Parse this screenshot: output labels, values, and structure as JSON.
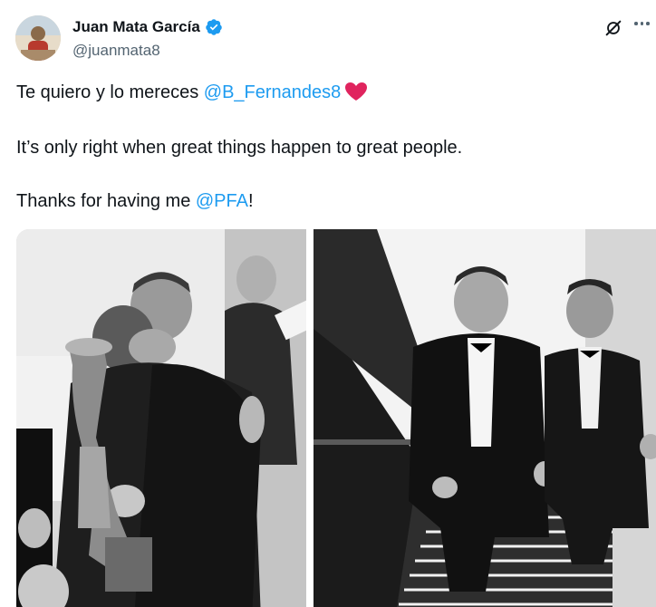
{
  "author": {
    "display_name": "Juan Mata García",
    "handle": "@juanmata8",
    "verified": true
  },
  "tweet": {
    "line1_text": "Te quiero y lo mereces ",
    "line1_mention": "@B_Fernandes8",
    "line2_text": "It’s only right when great things happen to great people.",
    "line3_text": "Thanks for having me ",
    "line3_mention": "@PFA",
    "line3_suffix": "!"
  },
  "icons": {
    "verified": "verified-badge-icon",
    "grok": "grok-icon",
    "more": "more-options-icon",
    "heart": "red-heart-emoji"
  },
  "media": {
    "count": 2,
    "style": "black-and-white"
  },
  "colors": {
    "link": "#1d9bf0",
    "handle": "#536471",
    "text": "#0f1419",
    "heart": "#e0245e"
  }
}
